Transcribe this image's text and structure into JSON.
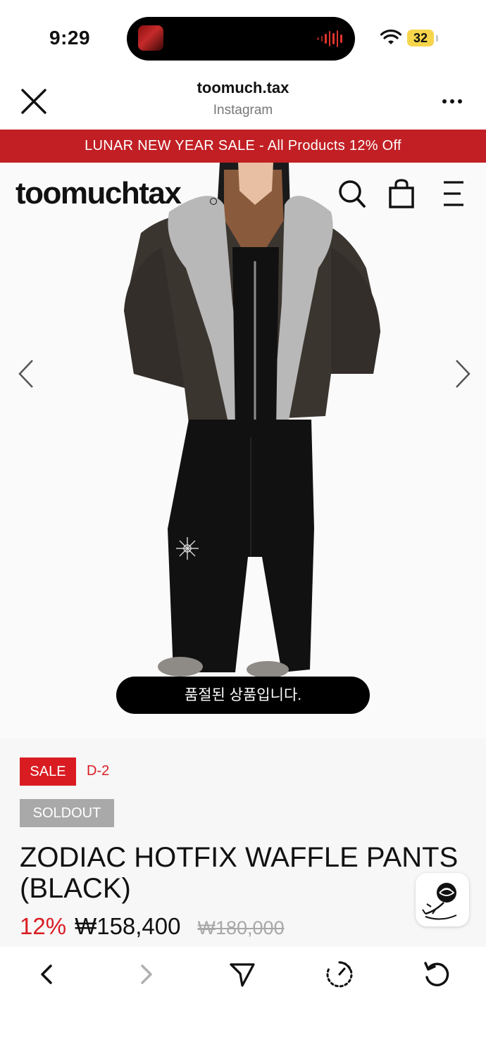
{
  "status_bar": {
    "time": "9:29",
    "battery": "32"
  },
  "browser": {
    "title": "toomuch.tax",
    "subtitle": "Instagram"
  },
  "banner": {
    "text": "LUNAR NEW YEAR SALE - All Products 12% Off",
    "color": "#c11f24"
  },
  "site_header": {
    "brand": "toomuchtax",
    "icons": [
      "search-icon",
      "shopping-bag-icon",
      "menu-icon"
    ]
  },
  "hero": {
    "soldout_notice": "품절된 상품입니다."
  },
  "product": {
    "sale_badge": "SALE",
    "days_left": "D-2",
    "soldout_badge": "SOLDOUT",
    "name": "ZODIAC HOTFIX WAFFLE PANTS (BLACK)",
    "discount": "12%",
    "price": "₩158,400",
    "original_price": "₩180,000",
    "accent_color": "#d91c22"
  },
  "toolbar": {
    "icons": [
      "back-icon",
      "forward-icon",
      "share-icon",
      "speed-icon",
      "reload-icon"
    ]
  }
}
